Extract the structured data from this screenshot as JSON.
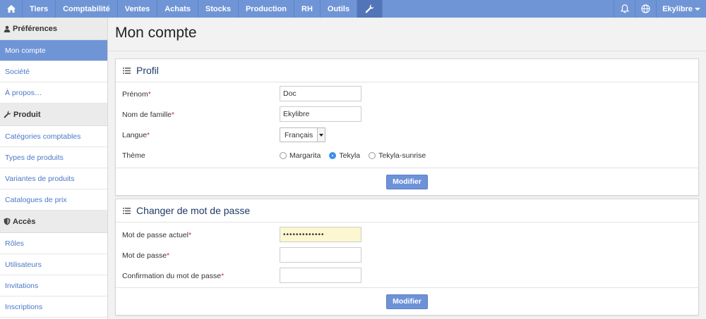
{
  "topnav": {
    "items": [
      "Tiers",
      "Comptabilité",
      "Ventes",
      "Achats",
      "Stocks",
      "Production",
      "RH",
      "Outils"
    ],
    "user": "Ekylibre"
  },
  "sidebar": {
    "sections": [
      {
        "title": "Préférences",
        "icon": "user-icon",
        "items": [
          {
            "label": "Mon compte",
            "active": true
          },
          {
            "label": "Société",
            "active": false
          },
          {
            "label": "À propos…",
            "active": false
          }
        ]
      },
      {
        "title": "Produit",
        "icon": "wrench-icon",
        "items": [
          {
            "label": "Catégories comptables",
            "active": false
          },
          {
            "label": "Types de produits",
            "active": false
          },
          {
            "label": "Variantes de produits",
            "active": false
          },
          {
            "label": "Catalogues de prix",
            "active": false
          }
        ]
      },
      {
        "title": "Accès",
        "icon": "shield-icon",
        "items": [
          {
            "label": "Rôles",
            "active": false
          },
          {
            "label": "Utilisateurs",
            "active": false
          },
          {
            "label": "Invitations",
            "active": false
          },
          {
            "label": "Inscriptions",
            "active": false
          }
        ]
      }
    ]
  },
  "page": {
    "title": "Mon compte"
  },
  "profile": {
    "title": "Profil",
    "first_name_label": "Prénom",
    "first_name_value": "Doc",
    "last_name_label": "Nom de famille",
    "last_name_value": "Ekylibre",
    "language_label": "Langue",
    "language_value": "Français",
    "theme_label": "Thème",
    "themes": [
      {
        "label": "Margarita",
        "checked": false
      },
      {
        "label": "Tekyla",
        "checked": true
      },
      {
        "label": "Tekyla-sunrise",
        "checked": false
      }
    ],
    "submit_label": "Modifier"
  },
  "password": {
    "title": "Changer de mot de passe",
    "current_label": "Mot de passe actuel",
    "current_value": "•••••••••••••",
    "new_label": "Mot de passe",
    "new_value": "",
    "confirm_label": "Confirmation du mot de passe",
    "confirm_value": "",
    "submit_label": "Modifier"
  },
  "required_marker": "*"
}
